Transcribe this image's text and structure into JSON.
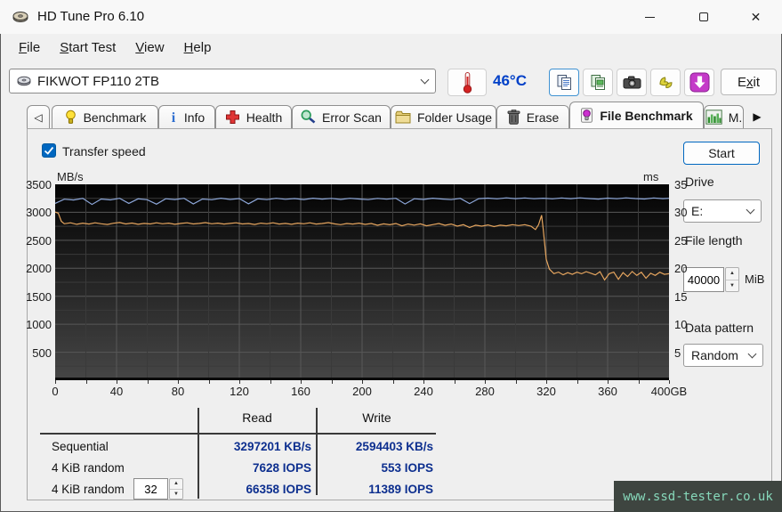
{
  "window": {
    "title": "HD Tune Pro 6.10",
    "controls": [
      "minimize",
      "maximize",
      "close"
    ]
  },
  "menu": {
    "items": [
      {
        "label": "File",
        "underline": 0
      },
      {
        "label": "Start Test",
        "underline": 0
      },
      {
        "label": "View",
        "underline": 0
      },
      {
        "label": "Help",
        "underline": 0
      }
    ]
  },
  "toolbar": {
    "drive_select": {
      "value": "FIKWOT FP110 2TB",
      "icon": "disk"
    },
    "temperature": "46°C",
    "buttons": [
      {
        "name": "copy-text",
        "icon": "copy",
        "selected": true
      },
      {
        "name": "copy-image",
        "icon": "copy-image",
        "selected": false
      },
      {
        "name": "screenshot",
        "icon": "camera",
        "selected": false
      },
      {
        "name": "hands",
        "icon": "hand",
        "selected": false
      },
      {
        "name": "save-download",
        "icon": "download",
        "selected": false
      }
    ],
    "exit": {
      "label": "Exit",
      "underline": 1
    }
  },
  "tabs": {
    "scroll_left": "◁",
    "scroll_right": "▶",
    "items": [
      {
        "label": "Benchmark",
        "icon": "bulb-yellow",
        "active": false
      },
      {
        "label": "Info",
        "icon": "info",
        "active": false
      },
      {
        "label": "Health",
        "icon": "health-cross",
        "active": false
      },
      {
        "label": "Error Scan",
        "icon": "magnifier",
        "active": false
      },
      {
        "label": "Folder Usage",
        "icon": "folder",
        "active": false
      },
      {
        "label": "Erase",
        "icon": "trash",
        "active": false
      },
      {
        "label": "File Benchmark",
        "icon": "bulb-purple",
        "active": true
      },
      {
        "label": "M.",
        "icon": "bar-chart",
        "active": false,
        "partial": true
      }
    ]
  },
  "controls": {
    "transfer_speed_label": "Transfer speed",
    "transfer_speed_checked": true,
    "start_label": "Start",
    "drive_label": "Drive",
    "drive_value": "E:",
    "file_length_label": "File length",
    "file_length_value": "40000",
    "file_length_unit": "MiB",
    "data_pattern_label": "Data pattern",
    "data_pattern_value": "Random"
  },
  "chart_data": {
    "type": "line",
    "title": "File Benchmark transfer speed vs position",
    "x_axis": {
      "min": 0,
      "max": 400,
      "tick_step": 40,
      "minor_step": 20,
      "tick_labels": [
        "0",
        "40",
        "80",
        "120",
        "160",
        "200",
        "240",
        "280",
        "320",
        "360",
        "400GB"
      ]
    },
    "y_left": {
      "label": "MB/s",
      "min": 0,
      "max": 3500,
      "tick_step": 500,
      "minor_step": 250,
      "tick_labels": [
        "3500",
        "3000",
        "2500",
        "2000",
        "1500",
        "1000",
        "500"
      ]
    },
    "y_right": {
      "label": "ms",
      "min": 0,
      "max": 35,
      "tick_step": 5,
      "tick_labels": [
        "35",
        "30",
        "25",
        "20",
        "15",
        "10",
        "5"
      ]
    },
    "grid": true,
    "legend_position": "none",
    "series": [
      {
        "name": "read-speed",
        "color": "#8ca6d8",
        "unit": "MB/s",
        "points": [
          [
            0,
            3160
          ],
          [
            6,
            3235
          ],
          [
            12,
            3220
          ],
          [
            18,
            3248
          ],
          [
            24,
            3140
          ],
          [
            30,
            3238
          ],
          [
            36,
            3222
          ],
          [
            42,
            3250
          ],
          [
            48,
            3160
          ],
          [
            54,
            3240
          ],
          [
            60,
            3225
          ],
          [
            66,
            3145
          ],
          [
            72,
            3242
          ],
          [
            78,
            3228
          ],
          [
            84,
            3250
          ],
          [
            90,
            3150
          ],
          [
            96,
            3238
          ],
          [
            102,
            3224
          ],
          [
            108,
            3252
          ],
          [
            114,
            3230
          ],
          [
            120,
            3246
          ],
          [
            126,
            3152
          ],
          [
            132,
            3240
          ],
          [
            138,
            3226
          ],
          [
            144,
            3250
          ],
          [
            150,
            3232
          ],
          [
            156,
            3245
          ],
          [
            162,
            3228
          ],
          [
            168,
            3252
          ],
          [
            174,
            3236
          ],
          [
            180,
            3248
          ],
          [
            186,
            3230
          ],
          [
            192,
            3250
          ],
          [
            198,
            3238
          ],
          [
            204,
            3226
          ],
          [
            210,
            3248
          ],
          [
            216,
            3234
          ],
          [
            222,
            3250
          ],
          [
            228,
            3148
          ],
          [
            234,
            3242
          ],
          [
            240,
            3230
          ],
          [
            246,
            3252
          ],
          [
            252,
            3238
          ],
          [
            258,
            3226
          ],
          [
            264,
            3248
          ],
          [
            270,
            3156
          ],
          [
            276,
            3244
          ],
          [
            282,
            3254
          ],
          [
            288,
            3240
          ],
          [
            294,
            3258
          ],
          [
            300,
            3244
          ],
          [
            306,
            3256
          ],
          [
            312,
            3242
          ],
          [
            318,
            3252
          ],
          [
            324,
            3240
          ],
          [
            330,
            3256
          ],
          [
            336,
            3244
          ],
          [
            342,
            3258
          ],
          [
            348,
            3246
          ],
          [
            354,
            3236
          ],
          [
            360,
            3254
          ],
          [
            366,
            3242
          ],
          [
            372,
            3258
          ],
          [
            378,
            3246
          ],
          [
            384,
            3238
          ],
          [
            390,
            3256
          ],
          [
            396,
            3244
          ],
          [
            400,
            3250
          ]
        ]
      },
      {
        "name": "write-speed",
        "color": "#e5a55f",
        "unit": "MB/s",
        "points": [
          [
            0,
            3005
          ],
          [
            2,
            2985
          ],
          [
            4,
            2840
          ],
          [
            6,
            2795
          ],
          [
            10,
            2812
          ],
          [
            14,
            2786
          ],
          [
            18,
            2806
          ],
          [
            22,
            2790
          ],
          [
            26,
            2812
          ],
          [
            30,
            2796
          ],
          [
            34,
            2782
          ],
          [
            38,
            2804
          ],
          [
            42,
            2818
          ],
          [
            46,
            2792
          ],
          [
            50,
            2808
          ],
          [
            54,
            2786
          ],
          [
            58,
            2802
          ],
          [
            62,
            2792
          ],
          [
            66,
            2812
          ],
          [
            70,
            2796
          ],
          [
            74,
            2806
          ],
          [
            78,
            2786
          ],
          [
            82,
            2802
          ],
          [
            86,
            2812
          ],
          [
            90,
            2792
          ],
          [
            94,
            2802
          ],
          [
            98,
            2816
          ],
          [
            102,
            2796
          ],
          [
            106,
            2806
          ],
          [
            110,
            2790
          ],
          [
            114,
            2802
          ],
          [
            118,
            2812
          ],
          [
            122,
            2792
          ],
          [
            126,
            2800
          ],
          [
            130,
            2782
          ],
          [
            134,
            2806
          ],
          [
            138,
            2796
          ],
          [
            142,
            2812
          ],
          [
            146,
            2790
          ],
          [
            150,
            2802
          ],
          [
            154,
            2786
          ],
          [
            158,
            2806
          ],
          [
            162,
            2796
          ],
          [
            166,
            2812
          ],
          [
            170,
            2790
          ],
          [
            174,
            2800
          ],
          [
            178,
            2816
          ],
          [
            182,
            2794
          ],
          [
            186,
            2780
          ],
          [
            190,
            2800
          ],
          [
            194,
            2790
          ],
          [
            198,
            2806
          ],
          [
            202,
            2784
          ],
          [
            206,
            2800
          ],
          [
            210,
            2768
          ],
          [
            214,
            2794
          ],
          [
            218,
            2778
          ],
          [
            222,
            2800
          ],
          [
            226,
            2758
          ],
          [
            230,
            2790
          ],
          [
            234,
            2772
          ],
          [
            238,
            2794
          ],
          [
            242,
            2758
          ],
          [
            246,
            2780
          ],
          [
            250,
            2800
          ],
          [
            254,
            2768
          ],
          [
            258,
            2790
          ],
          [
            262,
            2752
          ],
          [
            266,
            2780
          ],
          [
            270,
            2728
          ],
          [
            274,
            2770
          ],
          [
            278,
            2752
          ],
          [
            282,
            2774
          ],
          [
            286,
            2744
          ],
          [
            290,
            2770
          ],
          [
            294,
            2758
          ],
          [
            298,
            2780
          ],
          [
            302,
            2764
          ],
          [
            306,
            2780
          ],
          [
            310,
            2752
          ],
          [
            313,
            2692
          ],
          [
            315,
            2780
          ],
          [
            317,
            2948
          ],
          [
            318,
            2700
          ],
          [
            320,
            2160
          ],
          [
            322,
            1985
          ],
          [
            325,
            1905
          ],
          [
            328,
            1932
          ],
          [
            331,
            1884
          ],
          [
            334,
            1922
          ],
          [
            337,
            1892
          ],
          [
            340,
            1930
          ],
          [
            343,
            1902
          ],
          [
            346,
            1940
          ],
          [
            349,
            1912
          ],
          [
            352,
            1882
          ],
          [
            355,
            1940
          ],
          [
            358,
            1792
          ],
          [
            361,
            1902
          ],
          [
            364,
            1932
          ],
          [
            367,
            1802
          ],
          [
            370,
            1922
          ],
          [
            373,
            1852
          ],
          [
            376,
            1942
          ],
          [
            379,
            1872
          ],
          [
            382,
            1930
          ],
          [
            385,
            1822
          ],
          [
            388,
            1912
          ],
          [
            391,
            1872
          ],
          [
            394,
            1930
          ],
          [
            397,
            1892
          ],
          [
            400,
            1902
          ]
        ]
      }
    ]
  },
  "results_table": {
    "col_headers": [
      "Read",
      "Write"
    ],
    "rows": [
      {
        "label": "Sequential",
        "read": "3297201 KB/s",
        "write": "2594403 KB/s"
      },
      {
        "label": "4 KiB random",
        "read": "7628 IOPS",
        "write": "553 IOPS"
      },
      {
        "label": "4 KiB random",
        "queue_depth": "32",
        "read": "66358 IOPS",
        "write": "11389 IOPS"
      }
    ]
  },
  "watermark": {
    "text": "www.ssd-tester.co.uk"
  },
  "colors": {
    "accent_blue": "#0067c0",
    "temperature_blue": "#0040c8",
    "value_navy": "#0d2f8f",
    "read_line": "#8ca6d8",
    "write_line": "#e5a55f",
    "plot_bg_top": "#030303",
    "plot_bg_bottom": "#464646",
    "watermark_bg": "#3e4540",
    "watermark_fg": "#86d8ba",
    "download_button": "#c43ac8"
  }
}
